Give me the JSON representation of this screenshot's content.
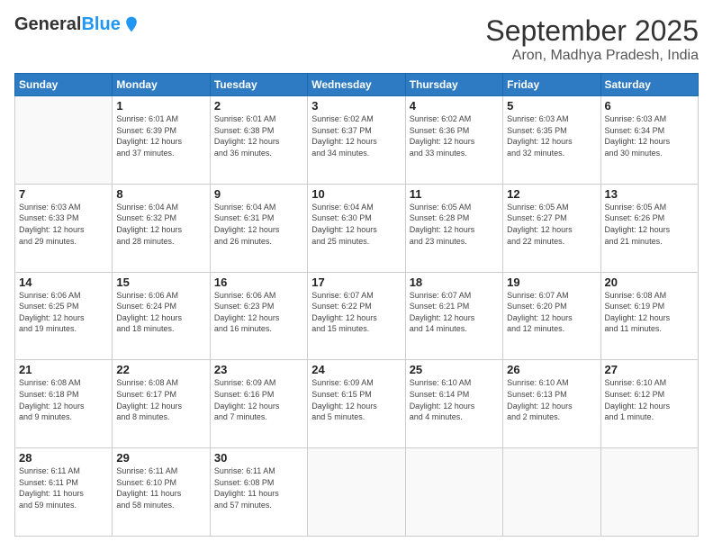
{
  "logo": {
    "line1": "General",
    "line2": "Blue"
  },
  "title": "September 2025",
  "location": "Aron, Madhya Pradesh, India",
  "weekdays": [
    "Sunday",
    "Monday",
    "Tuesday",
    "Wednesday",
    "Thursday",
    "Friday",
    "Saturday"
  ],
  "weeks": [
    [
      {
        "day": "",
        "info": ""
      },
      {
        "day": "1",
        "info": "Sunrise: 6:01 AM\nSunset: 6:39 PM\nDaylight: 12 hours\nand 37 minutes."
      },
      {
        "day": "2",
        "info": "Sunrise: 6:01 AM\nSunset: 6:38 PM\nDaylight: 12 hours\nand 36 minutes."
      },
      {
        "day": "3",
        "info": "Sunrise: 6:02 AM\nSunset: 6:37 PM\nDaylight: 12 hours\nand 34 minutes."
      },
      {
        "day": "4",
        "info": "Sunrise: 6:02 AM\nSunset: 6:36 PM\nDaylight: 12 hours\nand 33 minutes."
      },
      {
        "day": "5",
        "info": "Sunrise: 6:03 AM\nSunset: 6:35 PM\nDaylight: 12 hours\nand 32 minutes."
      },
      {
        "day": "6",
        "info": "Sunrise: 6:03 AM\nSunset: 6:34 PM\nDaylight: 12 hours\nand 30 minutes."
      }
    ],
    [
      {
        "day": "7",
        "info": "Sunrise: 6:03 AM\nSunset: 6:33 PM\nDaylight: 12 hours\nand 29 minutes."
      },
      {
        "day": "8",
        "info": "Sunrise: 6:04 AM\nSunset: 6:32 PM\nDaylight: 12 hours\nand 28 minutes."
      },
      {
        "day": "9",
        "info": "Sunrise: 6:04 AM\nSunset: 6:31 PM\nDaylight: 12 hours\nand 26 minutes."
      },
      {
        "day": "10",
        "info": "Sunrise: 6:04 AM\nSunset: 6:30 PM\nDaylight: 12 hours\nand 25 minutes."
      },
      {
        "day": "11",
        "info": "Sunrise: 6:05 AM\nSunset: 6:28 PM\nDaylight: 12 hours\nand 23 minutes."
      },
      {
        "day": "12",
        "info": "Sunrise: 6:05 AM\nSunset: 6:27 PM\nDaylight: 12 hours\nand 22 minutes."
      },
      {
        "day": "13",
        "info": "Sunrise: 6:05 AM\nSunset: 6:26 PM\nDaylight: 12 hours\nand 21 minutes."
      }
    ],
    [
      {
        "day": "14",
        "info": "Sunrise: 6:06 AM\nSunset: 6:25 PM\nDaylight: 12 hours\nand 19 minutes."
      },
      {
        "day": "15",
        "info": "Sunrise: 6:06 AM\nSunset: 6:24 PM\nDaylight: 12 hours\nand 18 minutes."
      },
      {
        "day": "16",
        "info": "Sunrise: 6:06 AM\nSunset: 6:23 PM\nDaylight: 12 hours\nand 16 minutes."
      },
      {
        "day": "17",
        "info": "Sunrise: 6:07 AM\nSunset: 6:22 PM\nDaylight: 12 hours\nand 15 minutes."
      },
      {
        "day": "18",
        "info": "Sunrise: 6:07 AM\nSunset: 6:21 PM\nDaylight: 12 hours\nand 14 minutes."
      },
      {
        "day": "19",
        "info": "Sunrise: 6:07 AM\nSunset: 6:20 PM\nDaylight: 12 hours\nand 12 minutes."
      },
      {
        "day": "20",
        "info": "Sunrise: 6:08 AM\nSunset: 6:19 PM\nDaylight: 12 hours\nand 11 minutes."
      }
    ],
    [
      {
        "day": "21",
        "info": "Sunrise: 6:08 AM\nSunset: 6:18 PM\nDaylight: 12 hours\nand 9 minutes."
      },
      {
        "day": "22",
        "info": "Sunrise: 6:08 AM\nSunset: 6:17 PM\nDaylight: 12 hours\nand 8 minutes."
      },
      {
        "day": "23",
        "info": "Sunrise: 6:09 AM\nSunset: 6:16 PM\nDaylight: 12 hours\nand 7 minutes."
      },
      {
        "day": "24",
        "info": "Sunrise: 6:09 AM\nSunset: 6:15 PM\nDaylight: 12 hours\nand 5 minutes."
      },
      {
        "day": "25",
        "info": "Sunrise: 6:10 AM\nSunset: 6:14 PM\nDaylight: 12 hours\nand 4 minutes."
      },
      {
        "day": "26",
        "info": "Sunrise: 6:10 AM\nSunset: 6:13 PM\nDaylight: 12 hours\nand 2 minutes."
      },
      {
        "day": "27",
        "info": "Sunrise: 6:10 AM\nSunset: 6:12 PM\nDaylight: 12 hours\nand 1 minute."
      }
    ],
    [
      {
        "day": "28",
        "info": "Sunrise: 6:11 AM\nSunset: 6:11 PM\nDaylight: 11 hours\nand 59 minutes."
      },
      {
        "day": "29",
        "info": "Sunrise: 6:11 AM\nSunset: 6:10 PM\nDaylight: 11 hours\nand 58 minutes."
      },
      {
        "day": "30",
        "info": "Sunrise: 6:11 AM\nSunset: 6:08 PM\nDaylight: 11 hours\nand 57 minutes."
      },
      {
        "day": "",
        "info": ""
      },
      {
        "day": "",
        "info": ""
      },
      {
        "day": "",
        "info": ""
      },
      {
        "day": "",
        "info": ""
      }
    ]
  ]
}
